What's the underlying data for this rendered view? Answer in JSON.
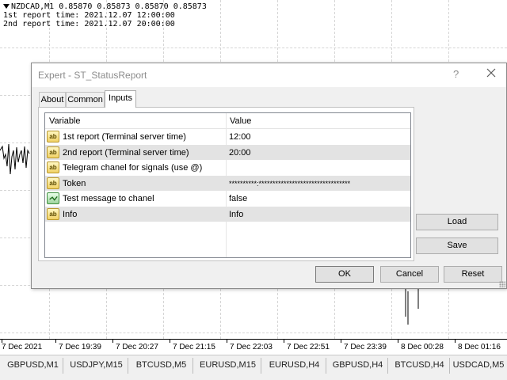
{
  "chart": {
    "symbol_line": "NZDCAD,M1  0.85870 0.85873 0.85870 0.85873",
    "report1_line": "1st report time: 2021.12.07 12:00:00",
    "report2_line": "2nd report time: 2021.12.07 20:00:00",
    "time_axis": [
      "7 Dec 2021",
      "7 Dec 19:39",
      "7 Dec 20:27",
      "7 Dec 21:15",
      "7 Dec 22:03",
      "7 Dec 22:51",
      "7 Dec 23:39",
      "8 Dec 00:28",
      "8 Dec 01:16"
    ]
  },
  "symbol_tabs": [
    "GBPUSD,M1",
    "USDJPY,M15",
    "BTCUSD,M5",
    "EURUSD,M15",
    "EURUSD,H4",
    "GBPUSD,H4",
    "BTCUSD,H4",
    "USDCAD,M5"
  ],
  "dialog": {
    "title": "Expert - ST_StatusReport",
    "help_glyph": "?",
    "tabs": [
      "About",
      "Common",
      "Inputs"
    ],
    "active_tab": "Inputs",
    "grid": {
      "headers": {
        "variable": "Variable",
        "value": "Value"
      },
      "rows": [
        {
          "icon": "ab",
          "type": "string-icon",
          "variable": "1st report (Terminal server time)",
          "value": "12:00"
        },
        {
          "icon": "ab",
          "type": "string-icon",
          "variable": "2nd report (Terminal server time)",
          "value": "20:00"
        },
        {
          "icon": "ab",
          "type": "string-icon",
          "variable": "Telegram chanel for signals (use @)",
          "value": ""
        },
        {
          "icon": "ab",
          "type": "string-icon",
          "variable": "Token",
          "value": "**********:*********************************"
        },
        {
          "icon": "",
          "type": "bool-icon",
          "variable": "Test message to chanel",
          "value": "false"
        },
        {
          "icon": "ab",
          "type": "string-icon",
          "variable": "Info",
          "value": "Info"
        }
      ]
    },
    "buttons": {
      "load": "Load",
      "save": "Save",
      "ok": "OK",
      "cancel": "Cancel",
      "reset": "Reset"
    }
  },
  "colors": {
    "chart_background": "#ffffff",
    "dialog_background": "#f0f0f0",
    "row_shade": "#e3e3e3",
    "grid_line": "#d6d6d6"
  }
}
